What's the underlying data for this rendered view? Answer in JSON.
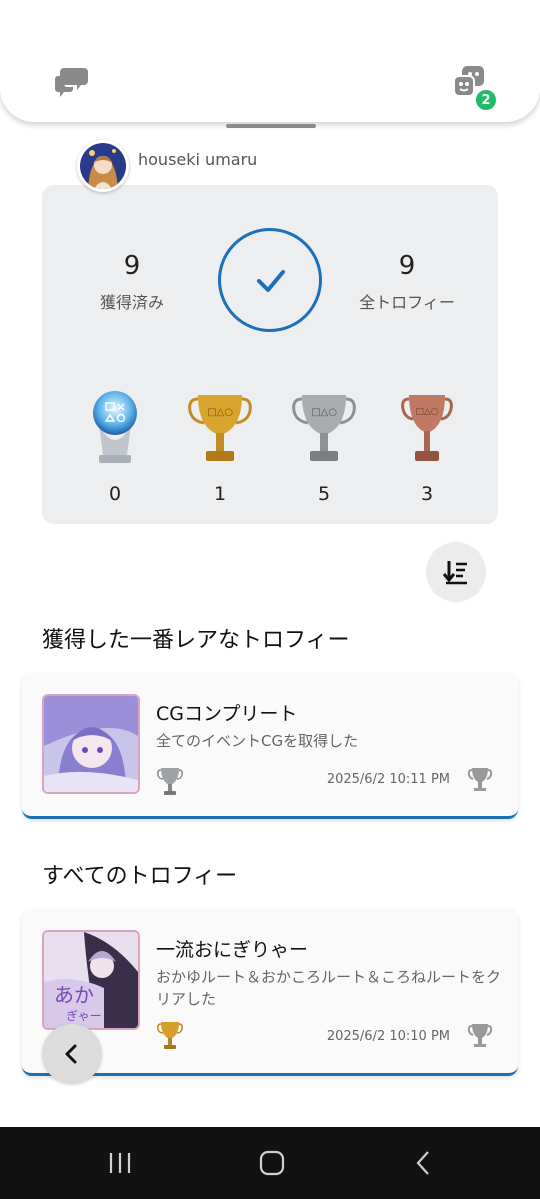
{
  "top_bar": {
    "chat_icon": "chat-bubbles-icon",
    "friends_icon": "friends-icon",
    "friends_badge": "2",
    "badge_color": "#1ebc6a"
  },
  "profile": {
    "username": "houseki umaru"
  },
  "summary": {
    "earned": {
      "value": "9",
      "label": "獲得済み"
    },
    "total": {
      "value": "9",
      "label": "全トロフィー"
    },
    "status_icon": "checkmark-circle-icon",
    "accent": "#1d6fb8",
    "trophies": [
      {
        "grade": "platinum",
        "count": "0"
      },
      {
        "grade": "gold",
        "count": "1"
      },
      {
        "grade": "silver",
        "count": "5"
      },
      {
        "grade": "bronze",
        "count": "3"
      }
    ]
  },
  "sort_button": {
    "icon": "sort-descending-icon"
  },
  "rarest": {
    "section_title": "獲得した一番レアなトロフィー",
    "card": {
      "title": "CGコンプリート",
      "description": "全てのイベントCGを取得した",
      "grade": "silver",
      "date": "2025/6/2  10:11 PM",
      "rarity_icon": "trophy-outline-icon"
    }
  },
  "all": {
    "section_title": "すべてのトロフィー",
    "card": {
      "title": "一流おにぎりゃー",
      "description": "おかゆルート＆おかころルート＆ころねルートをクリアした",
      "grade": "gold",
      "date": "2025/6/2  10:10 PM",
      "rarity_icon": "trophy-outline-icon"
    }
  },
  "floating_back": {
    "icon": "chevron-left-icon"
  },
  "system_nav": {
    "recent_icon": "recent-apps-icon",
    "home_icon": "home-icon",
    "back_icon": "back-icon"
  }
}
